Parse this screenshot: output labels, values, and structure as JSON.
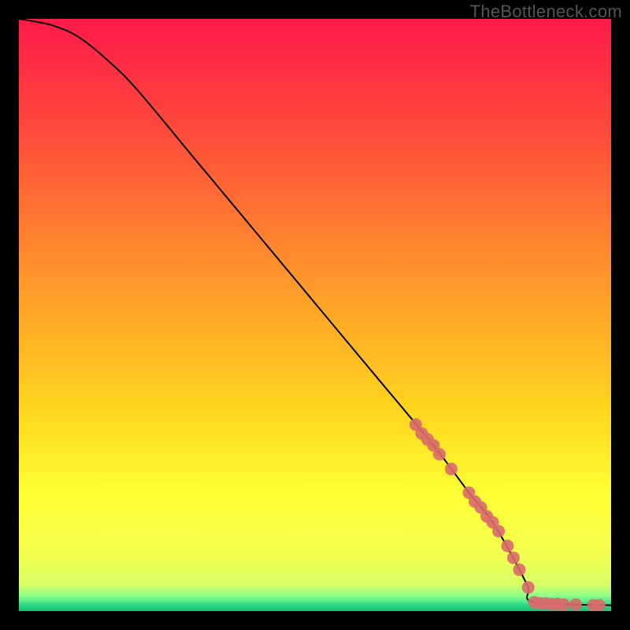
{
  "watermark": "TheBottleneck.com",
  "chart_data": {
    "type": "line",
    "title": "",
    "xlabel": "",
    "ylabel": "",
    "xlim": [
      0,
      100
    ],
    "ylim": [
      0,
      100
    ],
    "grid": false,
    "legend": false,
    "background_gradient_stops": [
      {
        "offset": 0.0,
        "color": "#ff1a4a"
      },
      {
        "offset": 0.2,
        "color": "#ff4d3a"
      },
      {
        "offset": 0.45,
        "color": "#ff9a2a"
      },
      {
        "offset": 0.65,
        "color": "#ffd21e"
      },
      {
        "offset": 0.8,
        "color": "#ffff33"
      },
      {
        "offset": 0.9,
        "color": "#f4ff4d"
      },
      {
        "offset": 0.955,
        "color": "#d9ff66"
      },
      {
        "offset": 0.975,
        "color": "#8aff8a"
      },
      {
        "offset": 0.99,
        "color": "#2bd98a"
      },
      {
        "offset": 1.0,
        "color": "#15c26e"
      }
    ],
    "series": [
      {
        "name": "curve",
        "type": "line",
        "color": "#000000",
        "points": [
          {
            "x": 0,
            "y": 100
          },
          {
            "x": 3,
            "y": 99.5
          },
          {
            "x": 6,
            "y": 98.8
          },
          {
            "x": 10,
            "y": 97
          },
          {
            "x": 15,
            "y": 93
          },
          {
            "x": 20,
            "y": 88
          },
          {
            "x": 30,
            "y": 76
          },
          {
            "x": 40,
            "y": 64
          },
          {
            "x": 50,
            "y": 52
          },
          {
            "x": 60,
            "y": 40
          },
          {
            "x": 70,
            "y": 28
          },
          {
            "x": 76,
            "y": 20
          },
          {
            "x": 80,
            "y": 15
          },
          {
            "x": 84,
            "y": 8
          },
          {
            "x": 86,
            "y": 4
          },
          {
            "x": 87,
            "y": 1.5
          },
          {
            "x": 100,
            "y": 1
          }
        ]
      },
      {
        "name": "scatter-on-curve",
        "type": "scatter",
        "color": "#d96a6a",
        "points": [
          {
            "x": 67,
            "y": 31.5
          },
          {
            "x": 68,
            "y": 30
          },
          {
            "x": 69,
            "y": 29
          },
          {
            "x": 70,
            "y": 28
          },
          {
            "x": 71,
            "y": 26.5
          },
          {
            "x": 73,
            "y": 24
          },
          {
            "x": 76,
            "y": 20
          },
          {
            "x": 77,
            "y": 18.5
          },
          {
            "x": 78,
            "y": 17.5
          },
          {
            "x": 79,
            "y": 16
          },
          {
            "x": 80,
            "y": 15
          },
          {
            "x": 81,
            "y": 13.5
          },
          {
            "x": 82.5,
            "y": 11
          },
          {
            "x": 83.5,
            "y": 9
          },
          {
            "x": 84.5,
            "y": 7
          },
          {
            "x": 86,
            "y": 4
          },
          {
            "x": 87,
            "y": 1.5
          },
          {
            "x": 88,
            "y": 1.3
          },
          {
            "x": 89,
            "y": 1.3
          },
          {
            "x": 90,
            "y": 1.2
          },
          {
            "x": 91,
            "y": 1.2
          },
          {
            "x": 92,
            "y": 1.1
          },
          {
            "x": 94,
            "y": 1.1
          },
          {
            "x": 97,
            "y": 1.0
          },
          {
            "x": 98,
            "y": 1.0
          }
        ]
      }
    ]
  }
}
